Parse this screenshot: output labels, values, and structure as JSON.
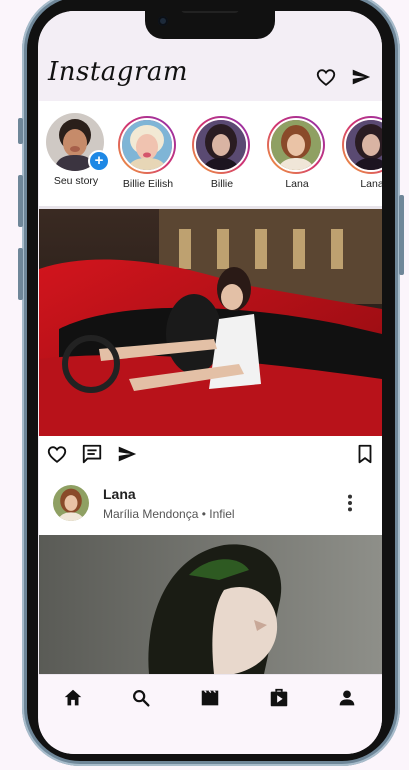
{
  "app": {
    "logo_text": "Instagram"
  },
  "header_icons": [
    "heart-icon",
    "send-icon"
  ],
  "stories": [
    {
      "name": "Seu story",
      "own": true
    },
    {
      "name": "Billie Eilish",
      "own": false
    },
    {
      "name": "Billie",
      "own": false
    },
    {
      "name": "Lana",
      "own": false
    },
    {
      "name": "Lana",
      "own": false
    }
  ],
  "story_add_badge": "+",
  "post_actions": [
    "heart-icon",
    "comment-icon",
    "send-icon",
    "bookmark-icon"
  ],
  "post": {
    "username": "Lana",
    "subtitle": "Marília Mendonça • Infiel"
  },
  "bottom_nav": [
    "home-icon",
    "search-icon",
    "reels-icon",
    "shop-icon",
    "profile-icon"
  ],
  "colors": {
    "story_ring_start": "#f2a43b",
    "story_ring_mid": "#d13471",
    "story_ring_end": "#8a2fb1",
    "add_badge": "#1e88e5",
    "phone_frame": "#6f8799"
  }
}
